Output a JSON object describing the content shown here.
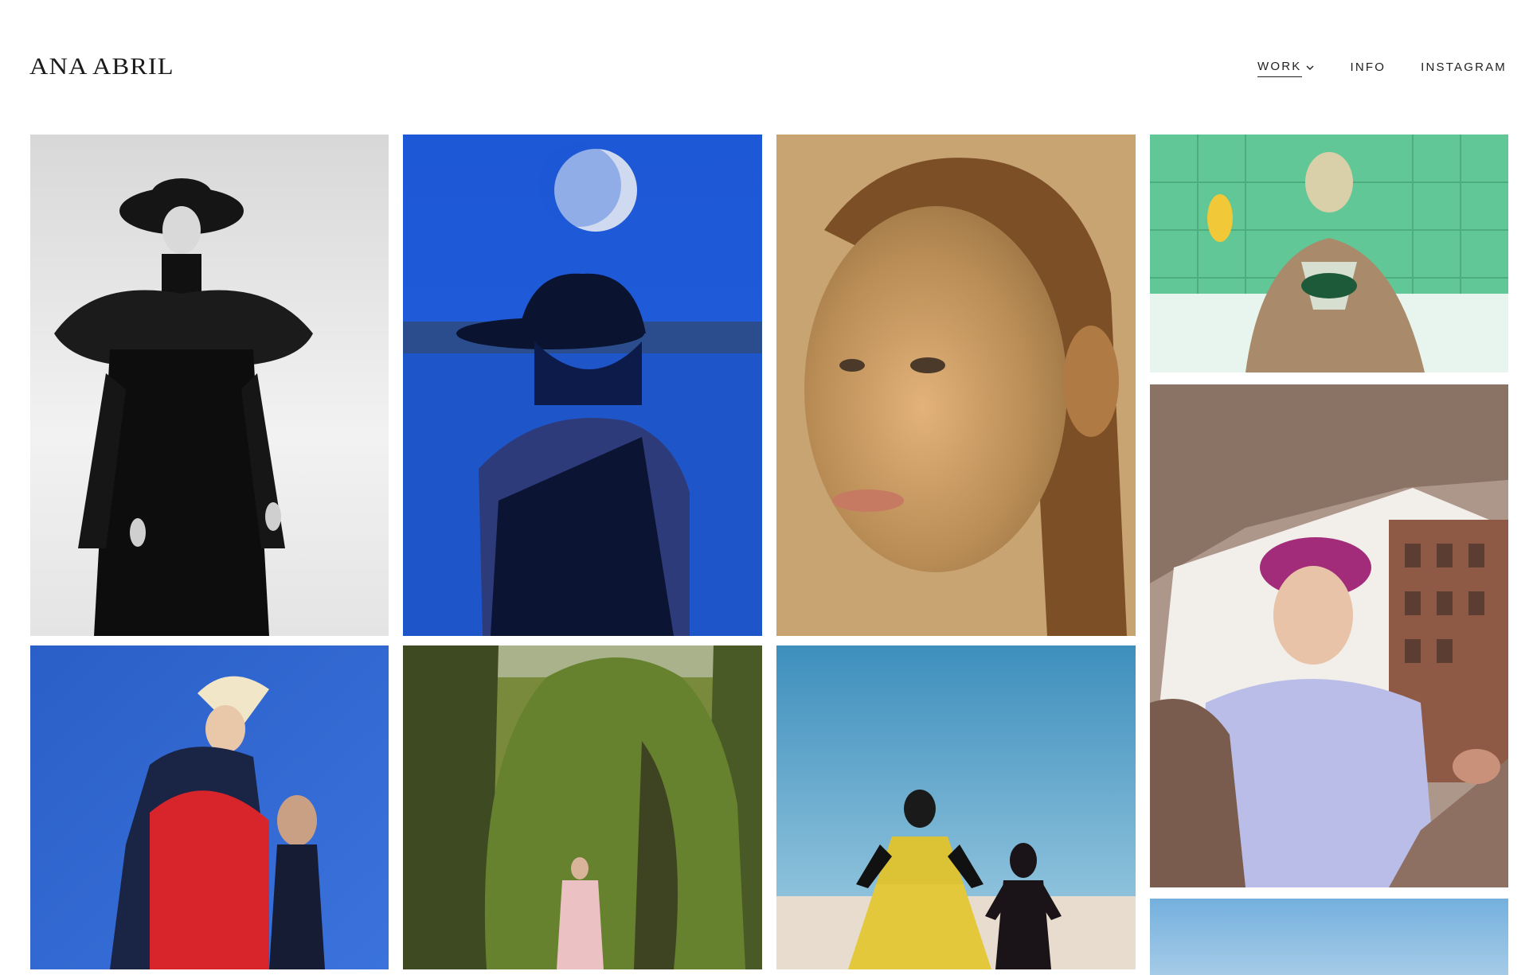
{
  "site": {
    "logo": "ANA ABRIL"
  },
  "nav": {
    "items": [
      {
        "label": "WORK",
        "active": true,
        "has_dropdown": true,
        "icon": "chevron-down-icon"
      },
      {
        "label": "INFO",
        "active": false
      },
      {
        "label": "INSTAGRAM",
        "active": false
      }
    ]
  },
  "gallery": {
    "photos": [
      {
        "subject": "black-and-white portrait, wide-brim hat, feathered collar",
        "palette": [
          "#e9e9e9",
          "#111111"
        ]
      },
      {
        "subject": "figure in hat under moon, blue salt desert",
        "palette": [
          "#1f5fd8",
          "#0a1a48"
        ]
      },
      {
        "subject": "close-up face portrait, warm amber tones",
        "palette": [
          "#c9a16a",
          "#8a5a30"
        ]
      },
      {
        "subject": "woman in green tiled bathtub",
        "palette": [
          "#6fcf9a",
          "#2f8a5c"
        ]
      },
      {
        "subject": "model in magenta hat seen through cardboard box",
        "palette": [
          "#b09888",
          "#9fa6e0"
        ]
      },
      {
        "subject": "two figures against blue sky, red knit dress",
        "palette": [
          "#2c63d2",
          "#d8232a"
        ]
      },
      {
        "subject": "model in pink coat before topiary hedge",
        "palette": [
          "#5f7a2a",
          "#e8b4b8"
        ]
      },
      {
        "subject": "yellow floral gown and black bodysuit figure in dunes",
        "palette": [
          "#4f9cc4",
          "#e6c43a"
        ]
      },
      {
        "subject": "blue sky fragment",
        "palette": [
          "#7fb6e0",
          "#a7cdea"
        ]
      }
    ]
  }
}
